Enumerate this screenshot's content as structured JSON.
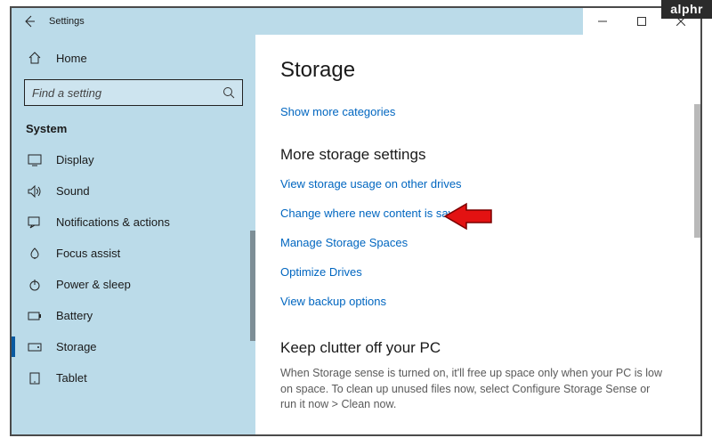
{
  "window": {
    "title": "Settings"
  },
  "sidebar": {
    "home_label": "Home",
    "search_placeholder": "Find a setting",
    "category": "System",
    "items": [
      {
        "label": "Display"
      },
      {
        "label": "Sound"
      },
      {
        "label": "Notifications & actions"
      },
      {
        "label": "Focus assist"
      },
      {
        "label": "Power & sleep"
      },
      {
        "label": "Battery"
      },
      {
        "label": "Storage"
      },
      {
        "label": "Tablet"
      }
    ]
  },
  "main": {
    "heading": "Storage",
    "show_more": "Show more categories",
    "more_settings_head": "More storage settings",
    "links": [
      "View storage usage on other drives",
      "Change where new content is saved",
      "Manage Storage Spaces",
      "Optimize Drives",
      "View backup options"
    ],
    "declutter_head": "Keep clutter off your PC",
    "declutter_desc": "When Storage sense is turned on, it'll free up space only when your PC is low on space. To clean up unused files now, select Configure Storage Sense or run it now > Clean now."
  },
  "badge": "alphr"
}
